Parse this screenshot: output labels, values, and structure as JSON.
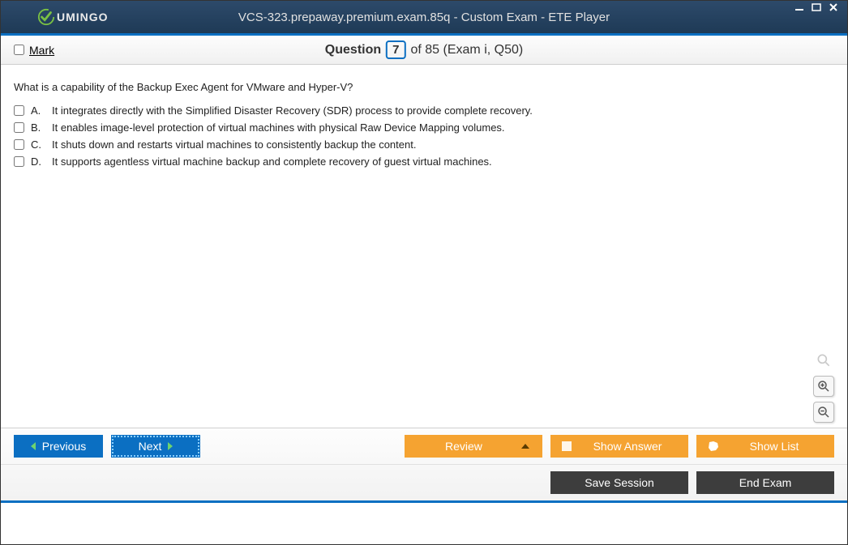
{
  "window": {
    "title": "VCS-323.prepaway.premium.exam.85q - Custom Exam - ETE Player",
    "logo_text": "UMINGO"
  },
  "header": {
    "mark_label": "Mark",
    "question_word": "Question",
    "question_number": "7",
    "of_text": "of 85 (Exam i, Q50)"
  },
  "question": {
    "text": "What is a capability of the Backup Exec Agent for VMware and Hyper-V?",
    "options": [
      {
        "letter": "A.",
        "text": "It integrates directly with the Simplified Disaster Recovery (SDR) process to provide complete recovery."
      },
      {
        "letter": "B.",
        "text": "It enables image-level protection of virtual machines with physical Raw Device Mapping volumes."
      },
      {
        "letter": "C.",
        "text": "It shuts down and restarts virtual machines to consistently backup the content."
      },
      {
        "letter": "D.",
        "text": "It supports agentless virtual machine backup and complete recovery of guest virtual machines."
      }
    ]
  },
  "footer": {
    "previous": "Previous",
    "next": "Next",
    "review": "Review",
    "show_answer": "Show Answer",
    "show_list": "Show List",
    "save_session": "Save Session",
    "end_exam": "End Exam"
  }
}
